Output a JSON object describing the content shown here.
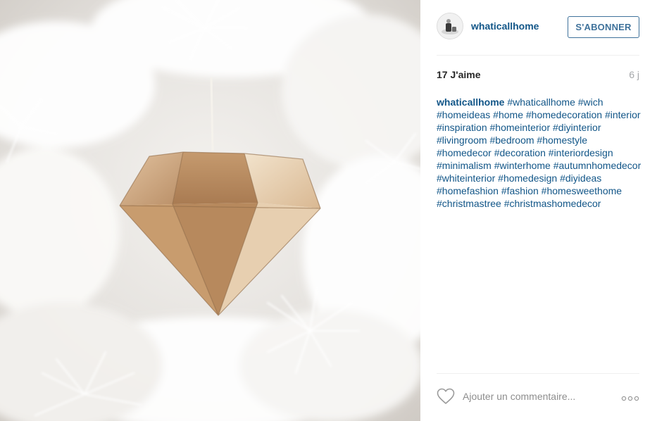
{
  "post": {
    "username": "whaticallhome",
    "follow_label": "S'ABONNER",
    "likes_text": "17 J'aime",
    "time_ago": "6 j",
    "caption_user": "whaticallhome",
    "hashtags": [
      "#whaticallhome",
      "#wich",
      "#homeideas",
      "#home",
      "#homedecoration",
      "#interior",
      "#inspiration",
      "#homeinterior",
      "#diyinterior",
      "#livingroom",
      "#bedroom",
      "#homestyle",
      "#homedecor",
      "#decoration",
      "#interiordesign",
      "#minimalism",
      "#winterhome",
      "#autumnhomedecor",
      "#whiteinterior",
      "#homedesign",
      "#diyideas",
      "#homefashion",
      "#fashion",
      "#homesweethome",
      "#christmastree",
      "#christmashomedecor"
    ],
    "comment_placeholder": "Ajouter un commentaire...",
    "colors": {
      "link": "#125688",
      "button": "#3f729b",
      "muted": "#a5a7aa"
    },
    "icons": [
      "heart-icon",
      "more-options-icon"
    ]
  }
}
